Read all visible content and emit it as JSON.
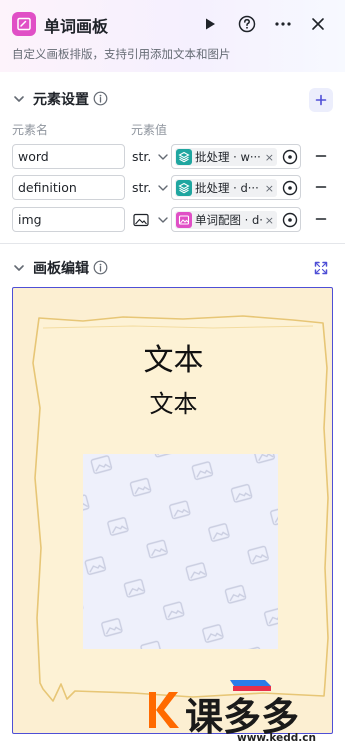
{
  "header": {
    "title": "单词画板",
    "subtitle": "自定义画板排版，支持引用添加文本和图片",
    "actions": [
      "play-icon",
      "help-icon",
      "more-icon",
      "close-icon"
    ]
  },
  "elements_section": {
    "title": "元素设置",
    "col_name": "元素名",
    "col_value": "元素值",
    "rows": [
      {
        "name": "word",
        "type": "str.",
        "source_icon": "batch-layers-icon",
        "source_color": "#1fa6a0",
        "value": "批处理 · w···"
      },
      {
        "name": "definition",
        "type": "str.",
        "source_icon": "batch-layers-icon",
        "source_color": "#1fa6a0",
        "value": "批处理 · d···"
      },
      {
        "name": "img",
        "type_icon": "image-type-icon",
        "source_icon": "image-node-icon",
        "source_color": "#e04fc6",
        "value": "单词配图 · d···"
      }
    ]
  },
  "canvas_section": {
    "title": "画板编辑",
    "text_1": "文本",
    "text_2": "文本"
  },
  "watermark": {
    "brand": "课多多",
    "url": "www.kedd.cn"
  },
  "colors": {
    "accent": "#4e4fd6",
    "canvas_bg": "#fcefd2",
    "paper": "#fdf2d5",
    "paper_border": "#e7c676"
  }
}
